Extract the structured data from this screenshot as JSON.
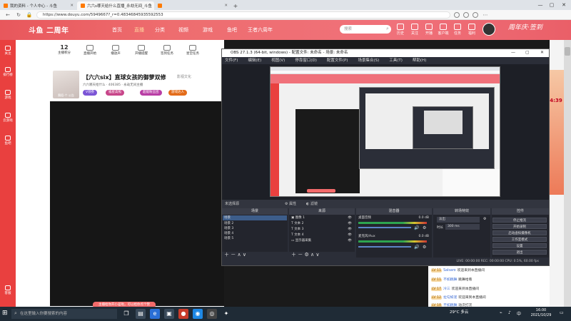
{
  "browser": {
    "tabs": [
      {
        "label": "我的资料 - 个人中心 - 斗鱼",
        "active": false
      },
      {
        "label": "六六s哪天给什么直播_永劫无间_斗鱼",
        "active": true
      },
      {
        "label": "",
        "active": false
      }
    ],
    "new_tab": "+",
    "url": "https://www.douyu.com/5949667?_r=0.48346845935592553"
  },
  "site": {
    "logo": "斗鱼 二周年",
    "nav": [
      "首页",
      "直播",
      "分类",
      "视频",
      "游戏",
      "鱼吧",
      "王者六周年"
    ],
    "search_placeholder": "搜索",
    "header_icons": [
      "历史",
      "关注",
      "开播",
      "客户端",
      "任务",
      "福利"
    ],
    "banner_text": "周年庆·签到"
  },
  "left_sidebar": [
    "关注",
    "排行榜",
    "游戏",
    "云游戏",
    "鱼吧",
    "直播"
  ],
  "left_sidebar_bottom": "客服",
  "stats": [
    {
      "num": "12",
      "label": "主播积分"
    },
    {
      "num": "",
      "label": "直播开始"
    },
    {
      "num": "",
      "label": "播放声"
    },
    {
      "num": "",
      "label": "开播提醒"
    },
    {
      "num": "",
      "label": "签到任务"
    },
    {
      "num": "",
      "label": "星空任务"
    }
  ],
  "room": {
    "title": "【六六six】直球女孩的御萝双修",
    "meta": "六六哪天给什么 · 406385 · 永劫无间主播",
    "category": "影视文化",
    "badges": [
      "V领券",
      "福星高照",
      "超能粉丝团",
      "游戏达人"
    ],
    "avatar_caption": "舞蹈-个 公告"
  },
  "player_toast": "主播给你开小差啦，可以给你点个赞",
  "chat": [
    {
      "level": "LV 11",
      "name": "Salsaro",
      "text": "欢迎来到本直播间"
    },
    {
      "level": "LV 11",
      "name": "不如跳舞",
      "text": "跳舞给看"
    },
    {
      "level": "LV 17",
      "name": "冷三",
      "text": "欢迎来到本直播间"
    },
    {
      "level": "LV 12",
      "name": "拉勾如泥",
      "text": "欢迎来到本直播间"
    },
    {
      "level": "LV 18",
      "name": "不如跳舞",
      "text": "动次打次"
    }
  ],
  "promo_time": "4:39",
  "obs": {
    "title": "OBS 27.1.3 (64-bit, windows) - 配置文件: 未命名 - 场景: 未命名",
    "menu": [
      "文件(F)",
      "编辑(E)",
      "视图(V)",
      "停靠窗口(D)",
      "配置文件(P)",
      "场景集合(S)",
      "工具(T)",
      "帮助(H)"
    ],
    "source_bar": "未选择源",
    "properties": "属性",
    "filters": "滤镜",
    "panels": {
      "scenes": {
        "header": "场景",
        "items": [
          "场景",
          "场景 2",
          "场景 3",
          "场景 4",
          "场景 5"
        ]
      },
      "sources": {
        "header": "来源",
        "items": [
          "图像 1",
          "文本 2",
          "文本 3",
          "文本 4",
          "显示器采集"
        ]
      },
      "mixer": {
        "header": "混音器",
        "tracks": [
          "桌面音频",
          "麦克风/Aux"
        ],
        "levels": [
          "0.0 dB",
          "0.0 dB"
        ]
      },
      "transitions": {
        "header": "转场特效",
        "type": "淡出",
        "duration_label": "时长",
        "duration": "300 ms"
      },
      "controls": {
        "header": "控件",
        "buttons": [
          "停止推流",
          "开始录制",
          "启动虚拟摄像机",
          "工作室模式",
          "设置",
          "退出"
        ]
      }
    },
    "status": "LIVE: 00:00:00    REC: 00:00:00    CPU: 0.5%, 60.00 fps"
  },
  "taskbar": {
    "search_placeholder": "在这里输入你要搜索的内容",
    "weather": "29°C 多云",
    "time": "16:00",
    "date": "2021/10/29"
  }
}
